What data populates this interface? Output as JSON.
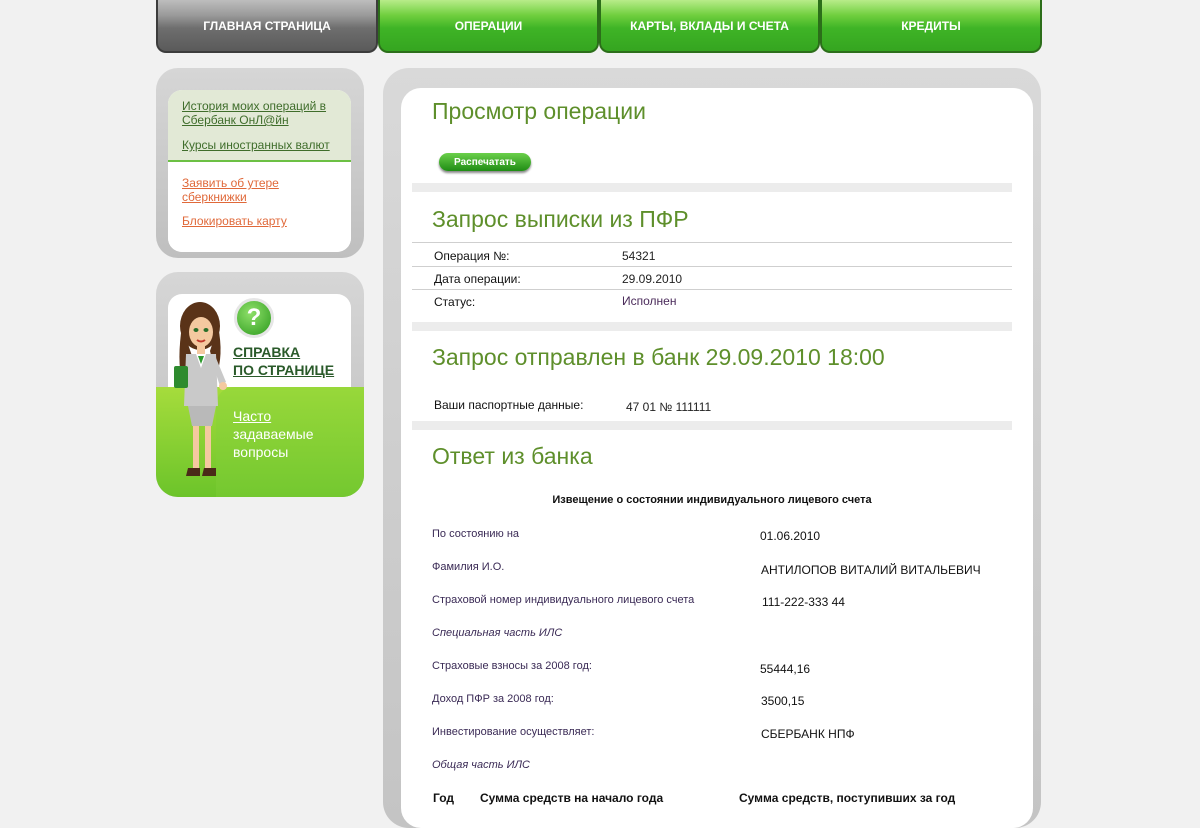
{
  "nav": {
    "tabs": [
      "ГЛАВНАЯ СТРАНИЦА",
      "ОПЕРАЦИИ",
      "КАРТЫ, ВКЛАДЫ И СЧЕТА",
      "КРЕДИТЫ"
    ]
  },
  "sidebar": {
    "links": [
      "История моих операций в Сбербанк ОнЛ@йн",
      "Курсы иностранных валют"
    ],
    "orange_links": [
      "Заявить об утере сберкнижки",
      "Блокировать карту"
    ],
    "help": {
      "title_line1": "СПРАВКА",
      "title_line2": "ПО СТРАНИЦЕ",
      "faq_line1": "Часто",
      "faq_line2": "задаваемые",
      "faq_line3": "вопросы",
      "q_icon": "?"
    }
  },
  "main": {
    "title": "Просмотр операции",
    "print_button": "Распечатать",
    "section1": {
      "title": "Запрос выписки из ПФР",
      "rows": [
        {
          "label": "Операция №:",
          "value": "54321"
        },
        {
          "label": "Дата операции:",
          "value": "29.09.2010"
        },
        {
          "label": "Статус:",
          "value": "Исполнен"
        }
      ]
    },
    "section2": {
      "title": "Запрос отправлен в банк 29.09.2010 18:00",
      "passport_label": "Ваши паспортные данные:",
      "passport_value": "47 01 № 111111"
    },
    "section3": {
      "title": "Ответ из банка",
      "notice_title": "Извещение о состоянии индивидуального лицевого счета",
      "rows": [
        {
          "label": "По состоянию на",
          "value": "01.06.2010"
        },
        {
          "label": "Фамилия И.О.",
          "value": "АНТИЛОПОВ ВИТАЛИЙ ВИТАЛЬЕВИЧ"
        },
        {
          "label": "Страховой номер индивидуального лицевого счета",
          "value": "111-222-333 44"
        },
        {
          "label": "Специальная часть ИЛС",
          "value": ""
        },
        {
          "label": "Страховые взносы за 2008 год:",
          "value": "55444,16"
        },
        {
          "label": "Доход ПФР за 2008 год:",
          "value": "3500,15"
        },
        {
          "label": "Инвестирование осуществляет:",
          "value": "СБЕРБАНК НПФ"
        },
        {
          "label": "Общая часть ИЛС",
          "value": ""
        }
      ],
      "table_headers": [
        "Год",
        "Сумма средств на начало года",
        "Сумма средств, поступивших за год"
      ]
    }
  },
  "colors": {
    "green_accent": "#5e8f2b",
    "tab_green": "#3fb426",
    "tab_active_gray": "#6e6e6e",
    "orange_link": "#e0693a"
  }
}
